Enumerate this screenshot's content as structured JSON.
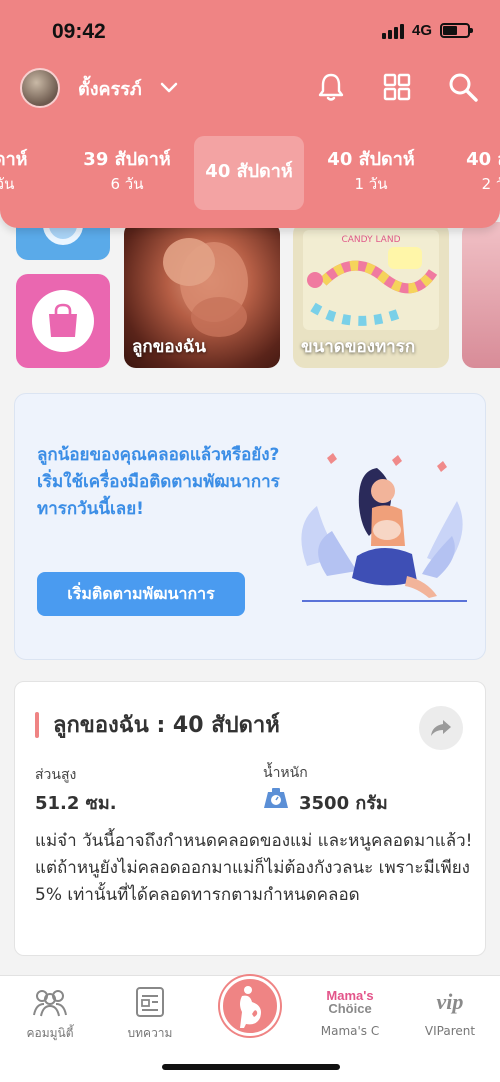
{
  "status": {
    "time": "09:42",
    "network": "4G"
  },
  "header": {
    "profile_name": "ตั้งครรภ์",
    "weeks": [
      {
        "label": "ปดาห์",
        "sub": "วัน"
      },
      {
        "label": "39 สัปดาห์",
        "sub": "6 วัน"
      },
      {
        "label": "40 สัปดาห์",
        "sub": ""
      },
      {
        "label": "40 สัปดาห์",
        "sub": "1 วัน"
      },
      {
        "label": "40 สัป",
        "sub": "2 วั"
      }
    ]
  },
  "cards": {
    "baby_label": "ลูกของฉัน",
    "size_label": "ขนาดของทารก",
    "candy_text": "CANDY LAND"
  },
  "promo": {
    "text": "ลูกน้อยของคุณคลอดแล้วหรือยัง? เริ่มใช้เครื่องมือติดตามพัฒนาการทารกวันนี้เลย!",
    "button": "เริ่มติดตามพัฒนาการ"
  },
  "info": {
    "title": "ลูกของฉัน :  40 สัปดาห์",
    "height_label": "ส่วนสูง",
    "height_value": "51.2 ซม.",
    "weight_label": "น้ำหนัก",
    "weight_value": "3500 กรัม",
    "description": "แม่จ๋า วันนี้อาจถึงกำหนดคลอดของแม่ และหนูคลอดมาแล้ว! แต่ถ้าหนูยังไม่คลอดออกมาแม่ก็ไม่ต้องกังวลนะ เพราะมีเพียง 5% เท่านั้นที่ได้คลอดทารกตามกำหนดคลอด"
  },
  "nav": {
    "community": "คอมมูนิตี้",
    "articles": "บทความ",
    "mamas_choice_logo_1": "Mama's",
    "mamas_choice_logo_2": "Chöice",
    "mamas_choice": "Mama's C",
    "vip_logo": "vip",
    "viparent": "VIParent"
  },
  "colors": {
    "header": "#ef8484",
    "accent_blue": "#4a9bf0",
    "promo_bg": "#eef3fc"
  }
}
